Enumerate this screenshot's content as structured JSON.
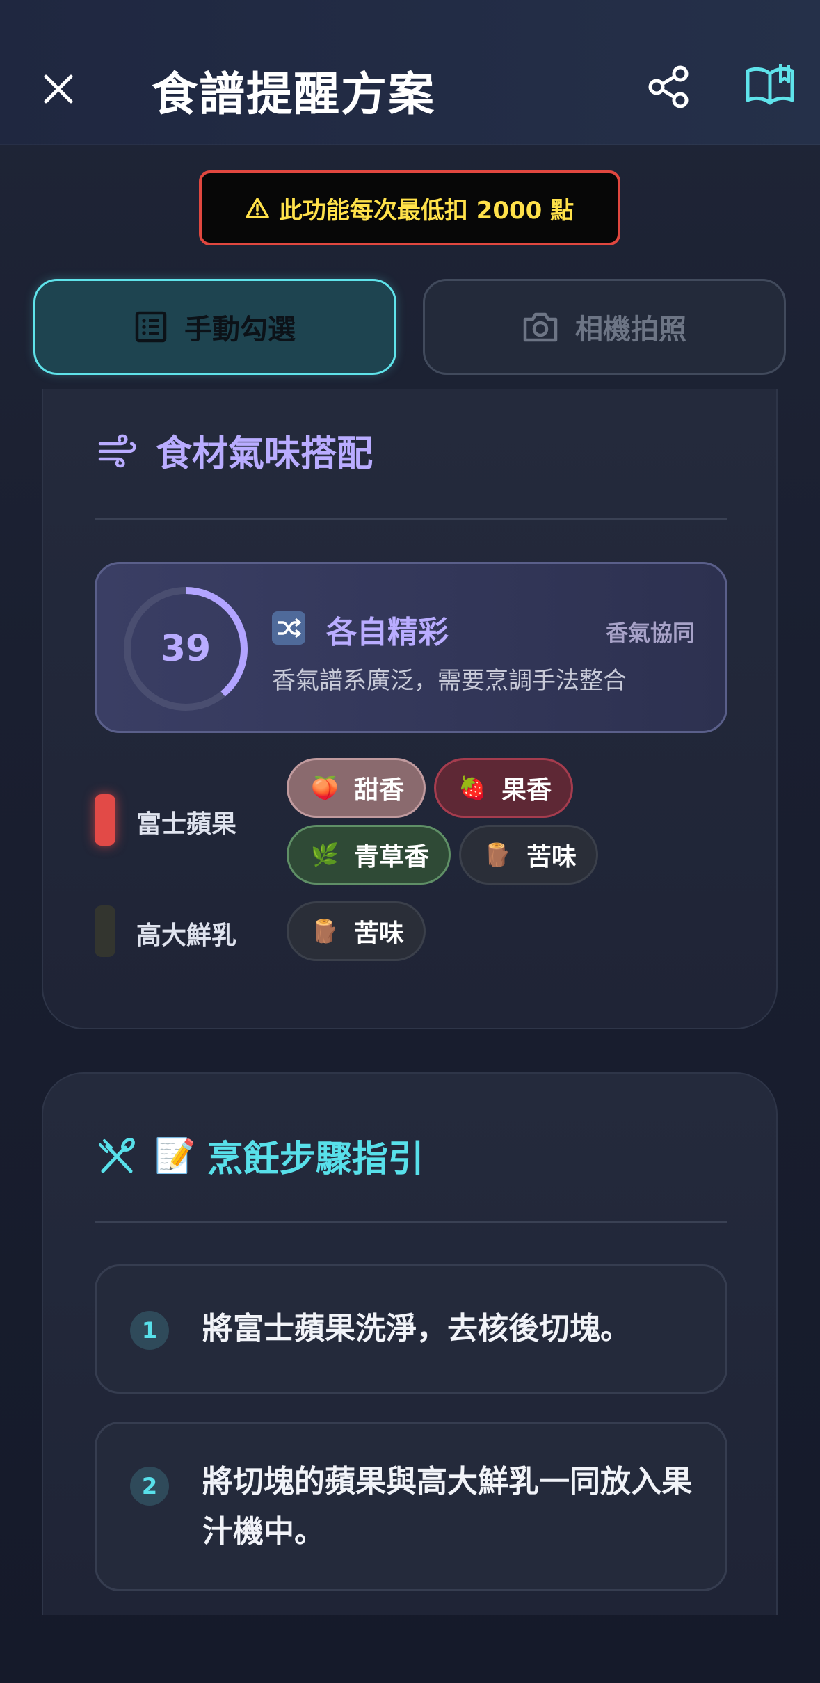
{
  "header": {
    "title": "食譜提醒方案"
  },
  "warning": {
    "icon": "warning-triangle-icon",
    "text_prefix": "此功能每次最低扣",
    "points": "2000",
    "text_suffix": "點"
  },
  "tabs": [
    {
      "label": "手動勾選",
      "icon": "list-icon",
      "active": true
    },
    {
      "label": "相機拍照",
      "icon": "camera-icon",
      "active": false
    }
  ],
  "aroma_card": {
    "title": "食材氣味搭配",
    "title_icon": "wind-icon",
    "score": {
      "value": "39",
      "fraction": 0.39,
      "icon": "🔀",
      "label": "各自精彩",
      "tag": "香氣協同",
      "description": "香氣譜系廣泛，需要烹調手法整合"
    },
    "ingredients": [
      {
        "name": "富士蘋果",
        "indicator_color": "#e24a47",
        "chips": [
          {
            "emoji": "🍑",
            "label": "甜香"
          },
          {
            "emoji": "🍓",
            "label": "果香"
          },
          {
            "emoji": "🌿",
            "label": "青草香"
          },
          {
            "emoji": "🪵",
            "label": "苦味"
          }
        ]
      },
      {
        "name": "高大鮮乳",
        "indicator_color": "#33352f",
        "chips": [
          {
            "emoji": "🪵",
            "label": "苦味"
          }
        ]
      }
    ]
  },
  "steps_card": {
    "title_emoji": "📝",
    "title": "烹飪步驟指引",
    "title_icon": "utensils-icon",
    "steps": [
      {
        "num": "1",
        "text": "將富士蘋果洗淨，去核後切塊。"
      },
      {
        "num": "2",
        "text": "將切塊的蘋果與高大鮮乳一同放入果汁機中。"
      }
    ]
  }
}
